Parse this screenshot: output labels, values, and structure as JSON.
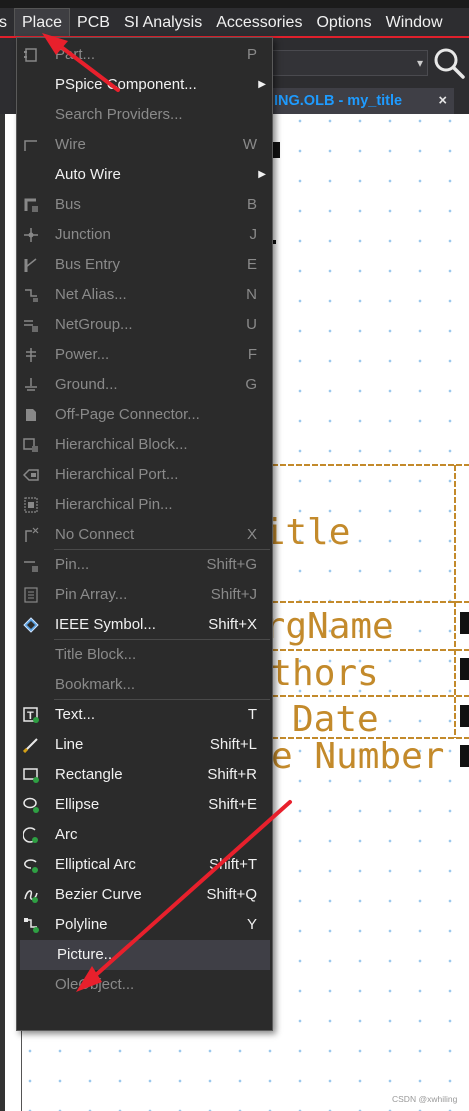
{
  "menubar": {
    "items": [
      "s",
      "Place",
      "PCB",
      "SI Analysis",
      "Accessories",
      "Options",
      "Window"
    ]
  },
  "tab": {
    "title": "ING.OLB - my_title",
    "close": "×"
  },
  "place_menu": {
    "items": [
      {
        "label": "Part...",
        "shortcut": "P",
        "enabled": false,
        "icon": "part-icon"
      },
      {
        "label": "PSpice Component...",
        "shortcut": "",
        "enabled": true,
        "submenu": true,
        "icon": ""
      },
      {
        "label": "Search Providers...",
        "shortcut": "",
        "enabled": false,
        "icon": ""
      },
      {
        "label": "Wire",
        "shortcut": "W",
        "enabled": false,
        "icon": "wire-icon"
      },
      {
        "label": "Auto Wire",
        "shortcut": "",
        "enabled": true,
        "submenu": true,
        "icon": ""
      },
      {
        "label": "Bus",
        "shortcut": "B",
        "enabled": false,
        "icon": "bus-icon"
      },
      {
        "label": "Junction",
        "shortcut": "J",
        "enabled": false,
        "icon": "junction-icon"
      },
      {
        "label": "Bus Entry",
        "shortcut": "E",
        "enabled": false,
        "icon": "bus-entry-icon"
      },
      {
        "label": "Net Alias...",
        "shortcut": "N",
        "enabled": false,
        "icon": "net-alias-icon"
      },
      {
        "label": "NetGroup...",
        "shortcut": "U",
        "enabled": false,
        "icon": "netgroup-icon"
      },
      {
        "label": "Power...",
        "shortcut": "F",
        "enabled": false,
        "icon": "power-icon"
      },
      {
        "label": "Ground...",
        "shortcut": "G",
        "enabled": false,
        "icon": "ground-icon"
      },
      {
        "label": "Off-Page Connector...",
        "shortcut": "",
        "enabled": false,
        "icon": "off-page-connector-icon"
      },
      {
        "label": "Hierarchical Block...",
        "shortcut": "",
        "enabled": false,
        "icon": "hierarchical-block-icon"
      },
      {
        "label": "Hierarchical Port...",
        "shortcut": "",
        "enabled": false,
        "icon": "hierarchical-port-icon"
      },
      {
        "label": "Hierarchical Pin...",
        "shortcut": "",
        "enabled": false,
        "icon": "hierarchical-pin-icon"
      },
      {
        "label": "No Connect",
        "shortcut": "X",
        "enabled": false,
        "icon": "no-connect-icon"
      },
      {
        "label": "Pin...",
        "shortcut": "Shift+G",
        "enabled": false,
        "icon": "pin-icon"
      },
      {
        "label": "Pin Array...",
        "shortcut": "Shift+J",
        "enabled": false,
        "icon": "pin-array-icon"
      },
      {
        "label": "IEEE Symbol...",
        "shortcut": "Shift+X",
        "enabled": true,
        "icon": "ieee-symbol-icon"
      },
      {
        "label": "Title Block...",
        "shortcut": "",
        "enabled": false,
        "icon": ""
      },
      {
        "label": "Bookmark...",
        "shortcut": "",
        "enabled": false,
        "icon": ""
      },
      {
        "label": "Text...",
        "shortcut": "T",
        "enabled": true,
        "icon": "text-icon"
      },
      {
        "label": "Line",
        "shortcut": "Shift+L",
        "enabled": true,
        "icon": "line-icon"
      },
      {
        "label": "Rectangle",
        "shortcut": "Shift+R",
        "enabled": true,
        "icon": "rectangle-icon"
      },
      {
        "label": "Ellipse",
        "shortcut": "Shift+E",
        "enabled": true,
        "icon": "ellipse-icon"
      },
      {
        "label": "Arc",
        "shortcut": "",
        "enabled": true,
        "icon": "arc-icon"
      },
      {
        "label": "Elliptical Arc",
        "shortcut": "Shift+T",
        "enabled": true,
        "icon": "elliptical-arc-icon"
      },
      {
        "label": "Bezier Curve",
        "shortcut": "Shift+Q",
        "enabled": true,
        "icon": "bezier-curve-icon"
      },
      {
        "label": "Polyline",
        "shortcut": "Y",
        "enabled": true,
        "icon": "polyline-icon"
      },
      {
        "label": "Picture...",
        "shortcut": "",
        "enabled": true,
        "highlighted": true,
        "icon": ""
      },
      {
        "label": "OleObject...",
        "shortcut": "",
        "enabled": false,
        "icon": ""
      }
    ]
  },
  "title_block": {
    "title": "Title",
    "orgname": "OrgName",
    "authors": "Authors",
    "date": "Date",
    "page": "Page Number"
  },
  "watermark": "CSDN @xwhiling",
  "colors": {
    "menubar": "#2d2d30",
    "menu_bg": "#2b2b2b",
    "accent_red": "#e0202c",
    "tab_text": "#1e9bff",
    "title_block": "#c38a2b",
    "grid_dot": "#9cc8ec"
  }
}
